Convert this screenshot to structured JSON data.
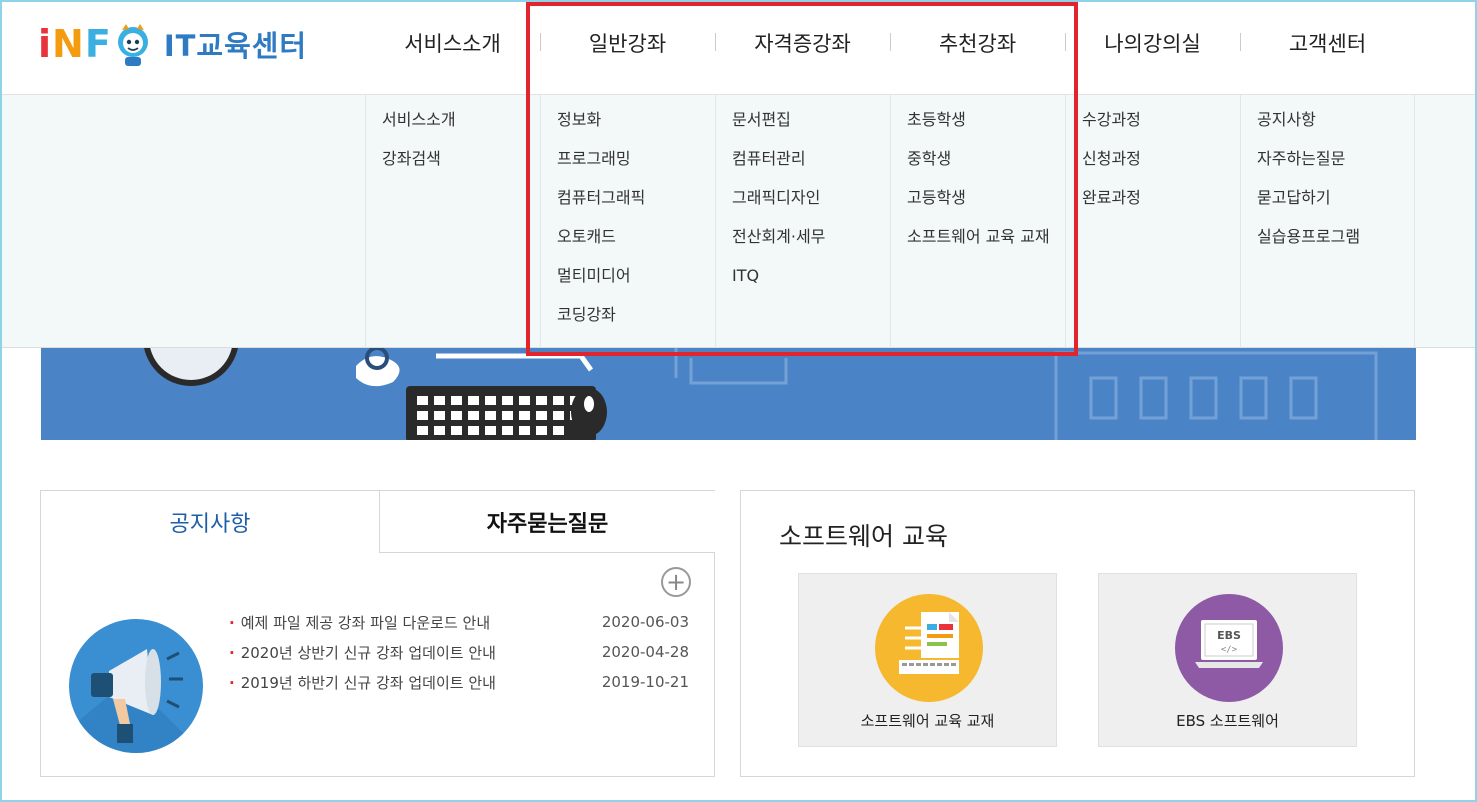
{
  "logo": {
    "letters": [
      "i",
      "N",
      "F"
    ],
    "text": "IT교육센터"
  },
  "gnb": [
    "서비스소개",
    "일반강좌",
    "자격증강좌",
    "추천강좌",
    "나의강의실",
    "고객센터"
  ],
  "dropdown": {
    "service": [
      "서비스소개",
      "강좌검색"
    ],
    "general": [
      "정보화",
      "프로그래밍",
      "컴퓨터그래픽",
      "오토캐드",
      "멀티미디어",
      "코딩강좌"
    ],
    "cert": [
      "문서편집",
      "컴퓨터관리",
      "그래픽디자인",
      "전산회계·세무",
      "ITQ"
    ],
    "recommend": [
      "초등학생",
      "중학생",
      "고등학생",
      "소프트웨어 교육 교재"
    ],
    "myroom": [
      "수강과정",
      "신청과정",
      "완료과정"
    ],
    "support": [
      "공지사항",
      "자주하는질문",
      "묻고답하기",
      "실습용프로그램"
    ]
  },
  "notice_panel": {
    "tab_notice": "공지사항",
    "tab_faq": "자주묻는질문",
    "more": "+",
    "items": [
      {
        "title": "예제 파일 제공 강좌 파일 다운로드 안내",
        "date": "2020-06-03"
      },
      {
        "title": "2020년 상반기 신규 강좌 업데이트 안내",
        "date": "2020-04-28"
      },
      {
        "title": "2019년 하반기 신규 강좌 업데이트 안내",
        "date": "2019-10-21"
      }
    ]
  },
  "software_panel": {
    "title": "소프트웨어 교육",
    "cards": [
      {
        "label": "소프트웨어 교육 교재"
      },
      {
        "label": "EBS 소프트웨어",
        "badge": "EBS",
        "code": "</>"
      }
    ]
  },
  "colors": {
    "highlight": "#e0252e",
    "banner": "#4a83c6",
    "accent": "#1f5fa8"
  }
}
